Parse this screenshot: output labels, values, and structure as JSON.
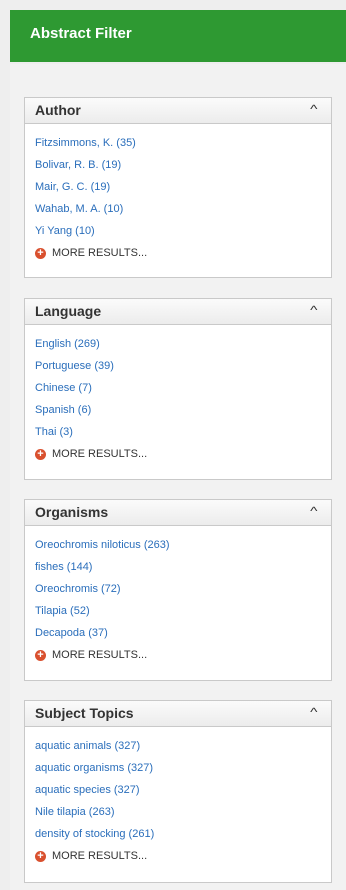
{
  "header": {
    "title": "Abstract Filter"
  },
  "more_label": "MORE RESULTS...",
  "facets": [
    {
      "title": "Author",
      "items": [
        "Fitzsimmons, K. (35)",
        "Bolivar, R. B. (19)",
        "Mair, G. C. (19)",
        "Wahab, M. A. (10)",
        "Yi Yang (10)"
      ]
    },
    {
      "title": "Language",
      "items": [
        "English (269)",
        "Portuguese (39)",
        "Chinese (7)",
        "Spanish (6)",
        "Thai (3)"
      ]
    },
    {
      "title": "Organisms",
      "items": [
        "Oreochromis niloticus (263)",
        "fishes (144)",
        "Oreochromis (72)",
        "Tilapia (52)",
        "Decapoda (37)"
      ]
    },
    {
      "title": "Subject Topics",
      "items": [
        "aquatic animals (327)",
        "aquatic organisms (327)",
        "aquatic species (327)",
        "Nile tilapia (263)",
        "density of stocking (261)"
      ]
    }
  ],
  "colors": {
    "header_bg": "#2e9932",
    "link": "#2a6ebb",
    "more_icon": "#d9502e"
  },
  "icons": {
    "collapse": "chevron-up-icon",
    "more": "plus-circle-icon"
  }
}
